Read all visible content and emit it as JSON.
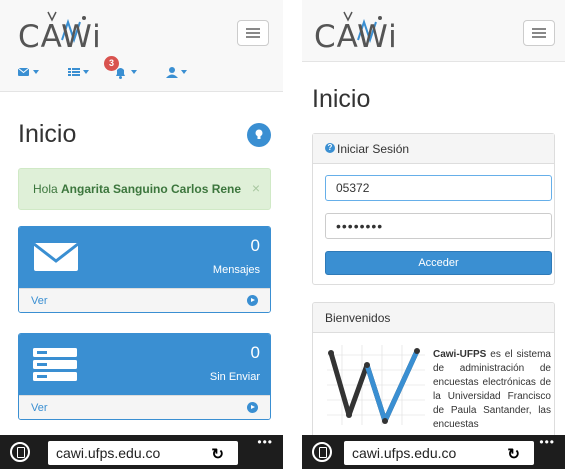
{
  "brand": {
    "logo_text": "CAWi"
  },
  "left": {
    "title": "Inicio",
    "notif_count": "3",
    "alert": {
      "greeting": "Hola ",
      "name": "Angarita Sanguino Carlos Rene",
      "close": "×"
    },
    "cards": [
      {
        "count": "0",
        "label": "Mensajes",
        "link": "Ver"
      },
      {
        "count": "0",
        "label": "Sin Enviar",
        "link": "Ver"
      }
    ]
  },
  "right": {
    "title": "Inicio",
    "login": {
      "title": "Iniciar Sesión",
      "username_value": "05372",
      "password_mask": "••••••••",
      "submit_label": "Acceder"
    },
    "welcome": {
      "title": "Bienvenidos",
      "brand": "Cawi-UFPS",
      "body": " es el sistema de administración de encuestas electrónicas de la Universidad Francisco de Paula Santander, las encuestas"
    }
  },
  "browser": {
    "url": "cawi.ufps.edu.co",
    "dots": "•••"
  },
  "colors": {
    "primary": "#3a8fd2",
    "success_bg": "#dff0d8",
    "success_text": "#3c763d",
    "danger": "#d9534f",
    "bar": "#1d1d1d"
  }
}
